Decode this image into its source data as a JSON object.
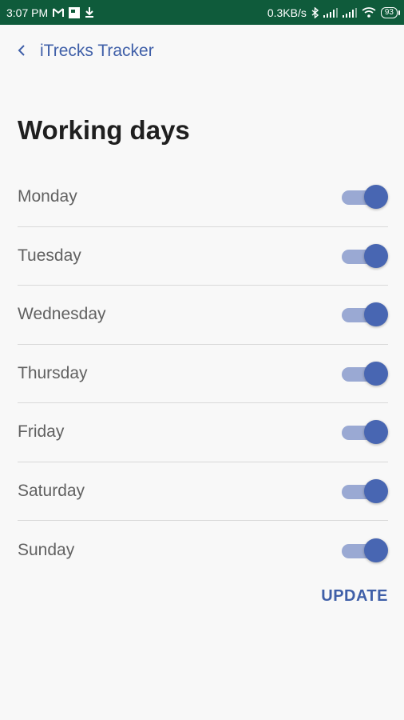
{
  "status_bar": {
    "time": "3:07 PM",
    "network_speed": "0.3KB/s",
    "battery_level": "93",
    "left_icons": [
      "gmail-icon",
      "notification-icon",
      "download-icon"
    ],
    "right_icons": [
      "bluetooth-icon",
      "signal-icon",
      "signal-icon",
      "wifi-icon",
      "battery-icon"
    ]
  },
  "header": {
    "back_icon": "chevron-left-icon",
    "app_title": "iTrecks Tracker"
  },
  "page": {
    "title": "Working days"
  },
  "days": [
    {
      "label": "Monday",
      "enabled": true
    },
    {
      "label": "Tuesday",
      "enabled": true
    },
    {
      "label": "Wednesday",
      "enabled": true
    },
    {
      "label": "Thursday",
      "enabled": true
    },
    {
      "label": "Friday",
      "enabled": true
    },
    {
      "label": "Saturday",
      "enabled": true
    },
    {
      "label": "Sunday",
      "enabled": true
    }
  ],
  "actions": {
    "update_label": "UPDATE"
  },
  "colors": {
    "status_bar": "#0f5b3b",
    "accent": "#3f5fa8",
    "switch_thumb": "#4866b2",
    "switch_track": "#9aa9d3",
    "background": "#f8f8f8"
  }
}
